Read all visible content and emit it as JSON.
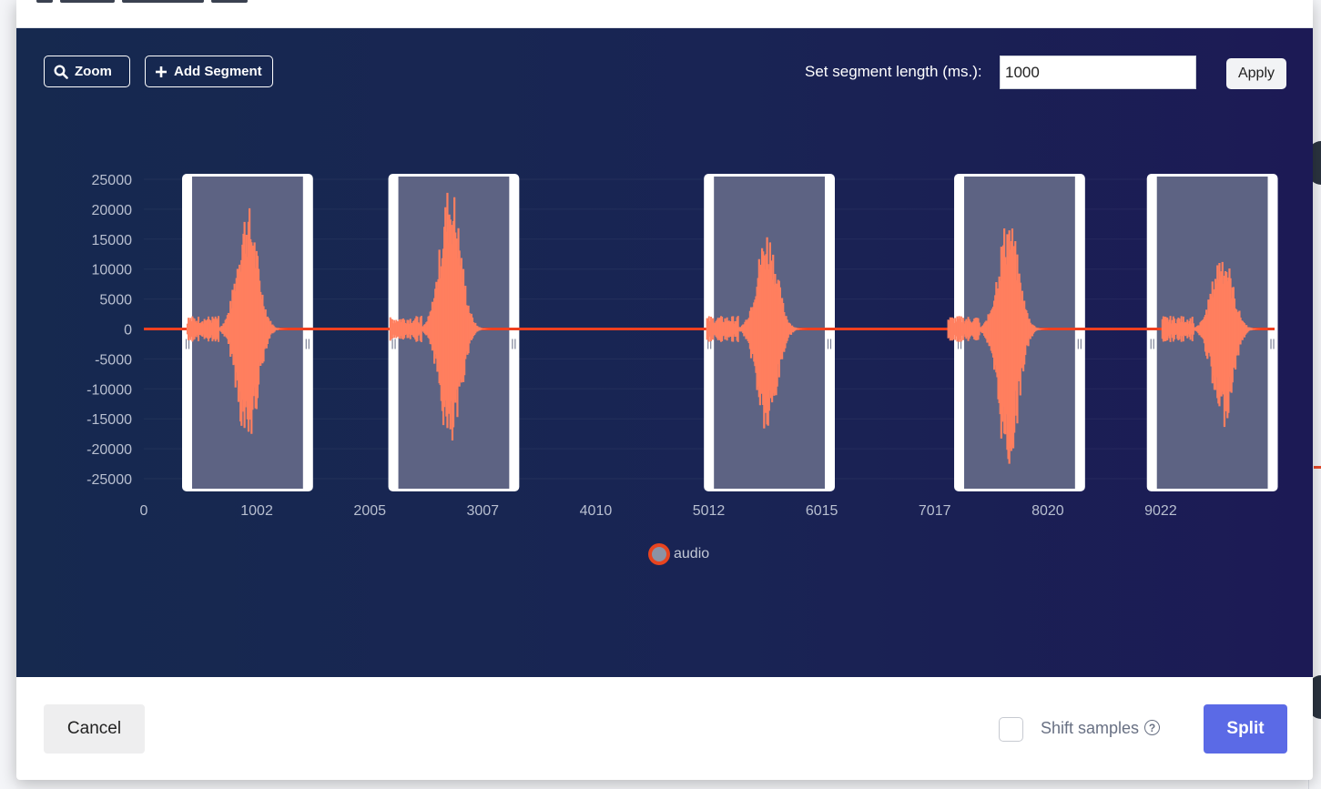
{
  "toolbar": {
    "zoom_label": "Zoom",
    "add_segment_label": "Add Segment",
    "segment_length_label": "Set segment length (ms.):",
    "segment_length_value": "1000",
    "apply_label": "Apply"
  },
  "footer": {
    "cancel_label": "Cancel",
    "shift_samples_label": "Shift samples",
    "shift_samples_checked": false,
    "split_label": "Split"
  },
  "colors": {
    "waveform": "#ff7f5f",
    "baseline": "#f0401f",
    "panel_bg": "#172451",
    "split_button": "#5b6ae6"
  },
  "chart_data": {
    "type": "line",
    "series": [
      {
        "name": "audio"
      }
    ],
    "y_ticks": [
      "25000",
      "20000",
      "15000",
      "10000",
      "5000",
      "0",
      "-5000",
      "-10000",
      "-15000",
      "-20000",
      "-25000"
    ],
    "x_ticks": [
      "0",
      "1002",
      "2005",
      "3007",
      "4010",
      "5012",
      "6015",
      "7017",
      "8020",
      "9022"
    ],
    "ylim": [
      -25000,
      25000
    ],
    "xlim": [
      0,
      10000
    ],
    "segments": [
      {
        "start": 420,
        "end": 1420
      },
      {
        "start": 2250,
        "end": 3250
      },
      {
        "start": 5050,
        "end": 6050
      },
      {
        "start": 7270,
        "end": 8270
      },
      {
        "start": 8980,
        "end": 9980
      }
    ],
    "bursts": [
      {
        "center": 920,
        "peak": 21000,
        "trough": -20500
      },
      {
        "center": 2720,
        "peak": 25000,
        "trough": -21500
      },
      {
        "center": 5530,
        "peak": 17000,
        "trough": -18500
      },
      {
        "center": 7670,
        "peak": 19000,
        "trough": -24000
      },
      {
        "center": 9570,
        "peak": 13500,
        "trough": -17000
      }
    ]
  }
}
